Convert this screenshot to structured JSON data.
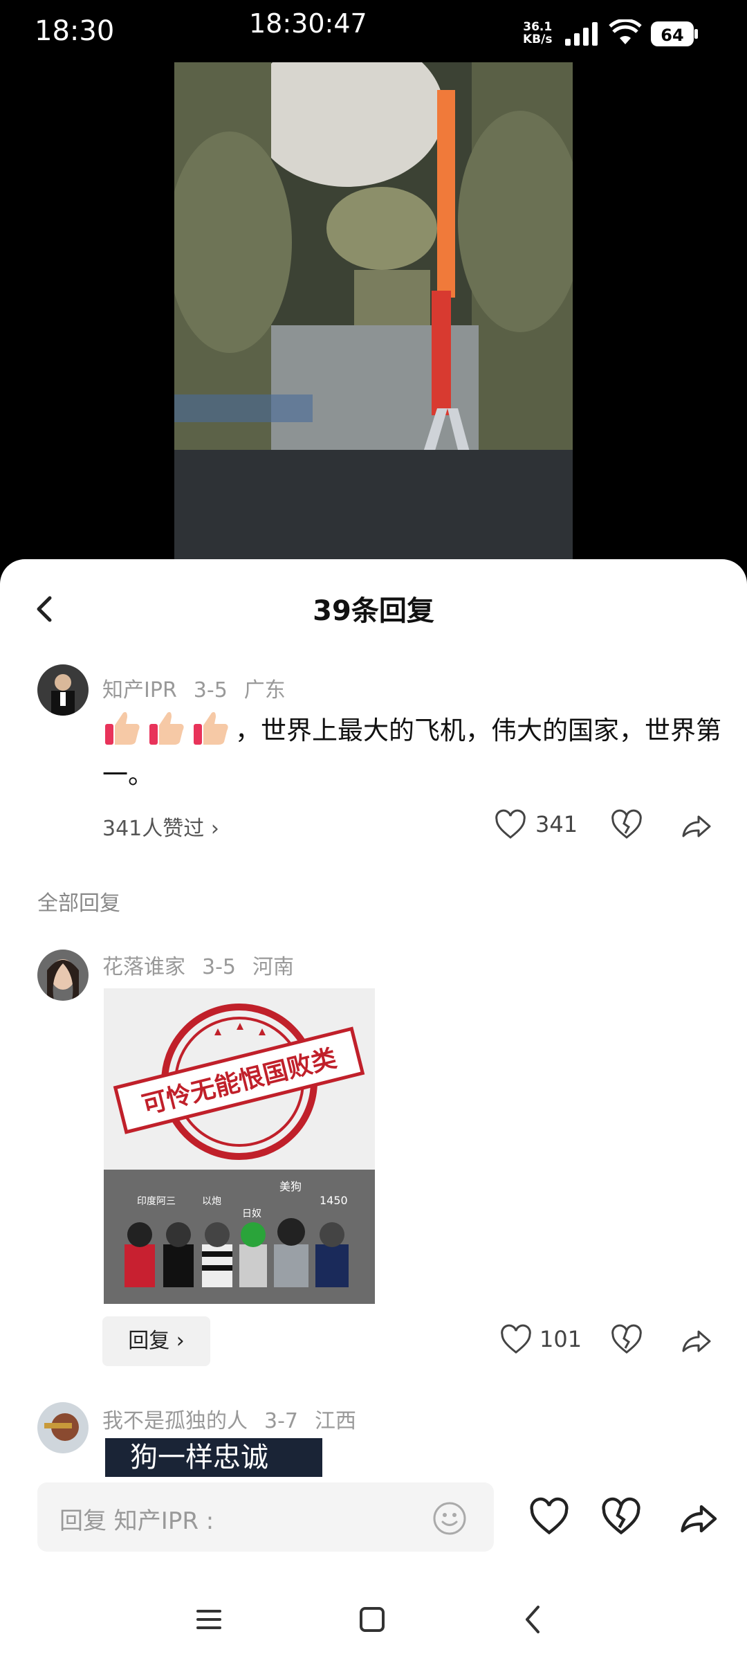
{
  "status_bar": {
    "time_left": "18:30",
    "time_center": "18:30:47",
    "speed_value": "36.1",
    "speed_unit": "KB/s",
    "battery": "64"
  },
  "sheet": {
    "title": "39条回复"
  },
  "main_comment": {
    "username": "知产IPR",
    "date": "3-5",
    "location": "广东",
    "text_after_emoji": "，世界上最大的飞机，伟大的国家，世界第一。",
    "liked_by": "341人赞过",
    "like_count": "341"
  },
  "all_replies_label": "全部回复",
  "replies": [
    {
      "username": "花落谁家",
      "date": "3-5",
      "location": "河南",
      "sticker_stamp_text": "可怜无能恨国败类",
      "sticker_dog_labels": [
        "印度阿三",
        "以炮",
        "日奴",
        "美狗",
        "1450"
      ],
      "reply_button": "回复",
      "like_count": "101"
    },
    {
      "username": "我不是孤独的人",
      "date": "3-7",
      "location": "江西",
      "image_caption": "狗一样忠诚"
    }
  ],
  "input": {
    "placeholder": "回复 知产IPR :"
  },
  "colors": {
    "accent_red": "#c0202a",
    "text_gray": "#999999"
  }
}
